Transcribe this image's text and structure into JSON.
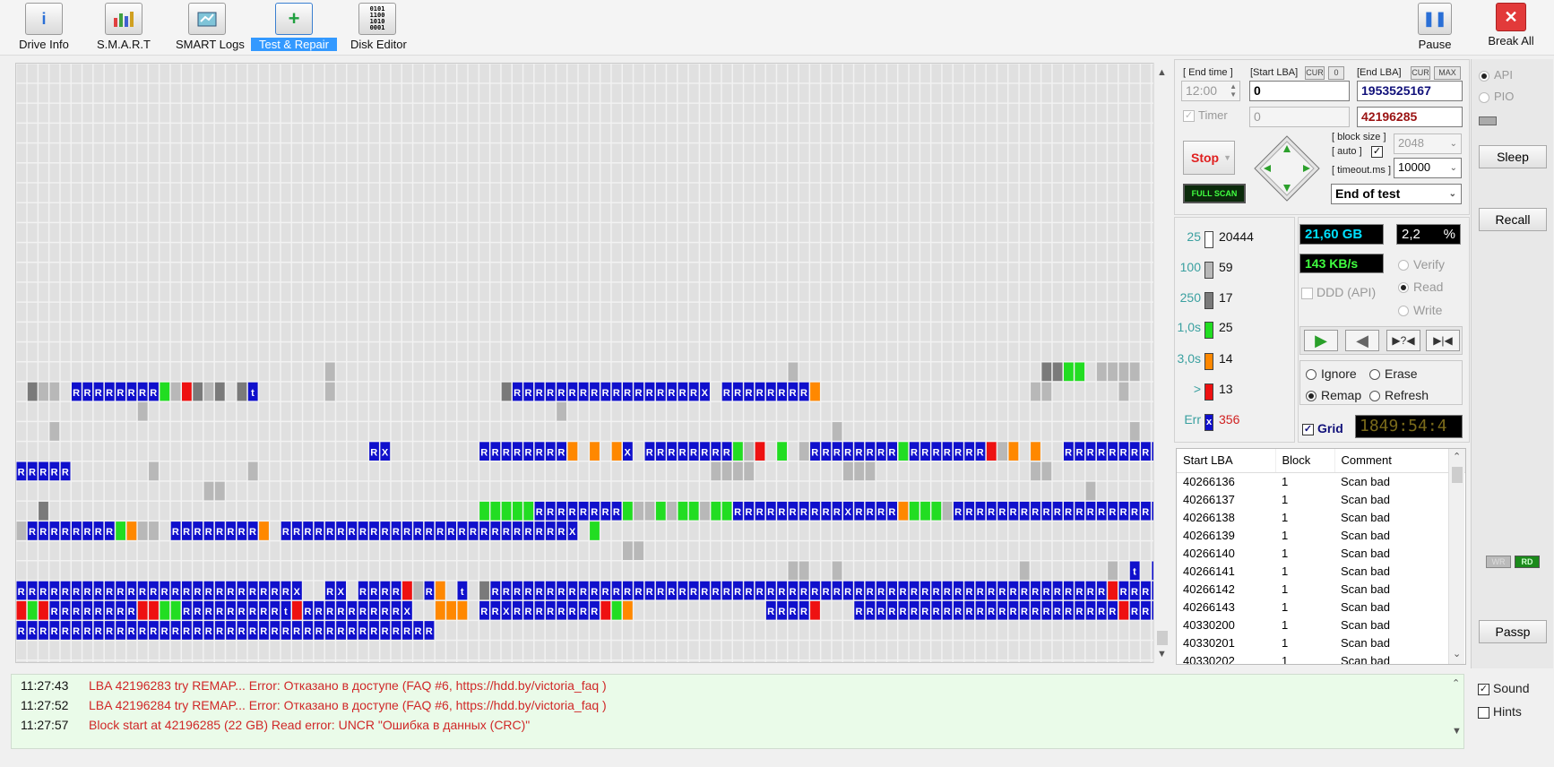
{
  "toolbar": {
    "buttons": [
      {
        "label": "Drive Info",
        "icon": "info-icon"
      },
      {
        "label": "S.M.A.R.T",
        "icon": "smart-icon"
      },
      {
        "label": "SMART Logs",
        "icon": "logs-icon"
      },
      {
        "label": "Test & Repair",
        "icon": "test-repair-icon"
      },
      {
        "label": "Disk Editor",
        "icon": "disk-editor-icon"
      }
    ],
    "pause": "Pause",
    "break_all": "Break All"
  },
  "controls": {
    "end_time_label": "[ End time ]",
    "start_lba_label": "[Start LBA]",
    "cur": "CUR",
    "zero": "0",
    "end_lba_label": "[End LBA]",
    "max": "MAX",
    "end_time": "12:00",
    "start_lba": "0",
    "end_lba": "1953525167",
    "timer_label": "Timer",
    "timer_value": "0",
    "current_lba": "42196285",
    "stop": "Stop",
    "full_scan": "FULL SCAN",
    "block_size_label": "[ block size ]",
    "auto_label": "[ auto ]",
    "block_size": "2048",
    "timeout_label": "[ timeout.ms ]",
    "timeout": "10000",
    "end_action": "End of test"
  },
  "legend": [
    {
      "label": "25",
      "count": "20444",
      "color": "#ffffff"
    },
    {
      "label": "100",
      "count": "59",
      "color": "#b8b8b8"
    },
    {
      "label": "250",
      "count": "17",
      "color": "#7a7a7a"
    },
    {
      "label": "1,0s",
      "count": "25",
      "color": "#22dd22"
    },
    {
      "label": "3,0s",
      "count": "14",
      "color": "#ff8800"
    },
    {
      "label": ">",
      "count": "13",
      "color": "#ee1111"
    },
    {
      "label": "Err",
      "count": "356",
      "color": "#1010cc"
    }
  ],
  "stats": {
    "size": "21,60 GB",
    "percent": "2,2",
    "percent_sign": "%",
    "speed": "143 KB/s",
    "verify": "Verify",
    "read": "Read",
    "write": "Write",
    "ddd": "DDD (API)",
    "ignore": "Ignore",
    "erase": "Erase",
    "remap": "Remap",
    "refresh": "Refresh",
    "grid": "Grid",
    "timer_display": "1849:54:4"
  },
  "table": {
    "headers": [
      "Start LBA",
      "Block",
      "Comment"
    ],
    "rows": [
      [
        "40266136",
        "1",
        "Scan bad"
      ],
      [
        "40266137",
        "1",
        "Scan bad"
      ],
      [
        "40266138",
        "1",
        "Scan bad"
      ],
      [
        "40266139",
        "1",
        "Scan bad"
      ],
      [
        "40266140",
        "1",
        "Scan bad"
      ],
      [
        "40266141",
        "1",
        "Scan bad"
      ],
      [
        "40266142",
        "1",
        "Scan bad"
      ],
      [
        "40266143",
        "1",
        "Scan bad"
      ],
      [
        "40330200",
        "1",
        "Scan bad"
      ],
      [
        "40330201",
        "1",
        "Scan bad"
      ],
      [
        "40330202",
        "1",
        "Scan bad"
      ]
    ]
  },
  "log": [
    {
      "time": "11:27:43",
      "msg": "LBA 42196283 try REMAP... Error: Отказано в доступе (FAQ #6, https://hdd.by/victoria_faq )"
    },
    {
      "time": "11:27:52",
      "msg": "LBA 42196284 try REMAP... Error: Отказано в доступе (FAQ #6, https://hdd.by/victoria_faq )"
    },
    {
      "time": "11:27:57",
      "msg": "Block start at 42196285 (22 GB) Read error: UNCR \"Ошибка в данных (CRC)\""
    }
  ],
  "side": {
    "api": "API",
    "pio": "PIO",
    "sleep": "Sleep",
    "recall": "Recall",
    "wr": "WR",
    "rd": "RD",
    "passp": "Passp",
    "sound": "Sound",
    "hints": "Hints"
  },
  "colors": {
    "err_blue": "#1010cc",
    "green": "#22dd22",
    "orange": "#ff8800",
    "red": "#ee1111",
    "gray_light": "#e0e0e0",
    "gray_mid": "#b8b8b8",
    "gray_dark": "#7a7a7a"
  }
}
